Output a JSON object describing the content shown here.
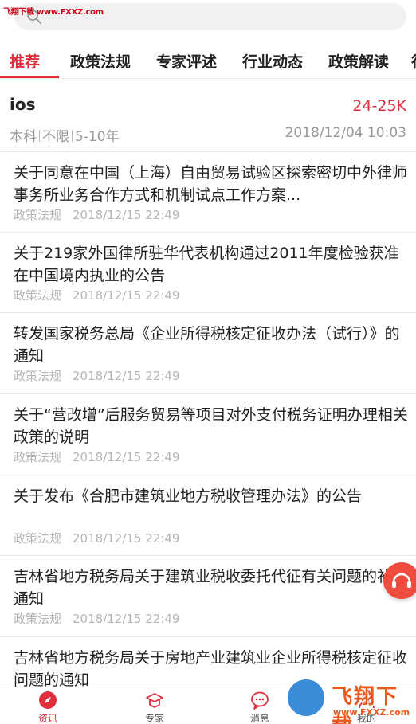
{
  "watermark_top": "飞翔下载 www.FXXZ.com",
  "search": {
    "placeholder": ""
  },
  "tabs": [
    {
      "label": "推荐",
      "active": true
    },
    {
      "label": "政策法规"
    },
    {
      "label": "专家评述"
    },
    {
      "label": "行业动态"
    },
    {
      "label": "政策解读"
    },
    {
      "label": "行"
    }
  ],
  "job": {
    "title": "ios",
    "salary": "24-25K",
    "education": "本科",
    "location": "不限",
    "experience": "5-10年",
    "time": "2018/12/04 10:03"
  },
  "articles": [
    {
      "title": "关于同意在中国（上海）自由贸易试验区探索密切中外律师事务所业务合作方式和机制试点工作方案...",
      "category": "政策法规",
      "date": "2018/12/15 22:49"
    },
    {
      "title": "关于219家外国律所驻华代表机构通过2011年度检验获准在中国境内执业的公告",
      "category": "政策法规",
      "date": "2018/12/15 22:49"
    },
    {
      "title": "转发国家税务总局《企业所得税核定征收办法（试行）》的通知",
      "category": "政策法规",
      "date": "2018/12/15 22:49"
    },
    {
      "title": "关于“营改增”后服务贸易等项目对外支付税务证明办理相关政策的说明",
      "category": "政策法规",
      "date": "2018/12/15 22:49"
    },
    {
      "title": "关于发布《合肥市建筑业地方税收管理办法》的公告",
      "category": "政策法规",
      "date": "2018/12/15 22:49"
    },
    {
      "title": "吉林省地方税务局关于建筑业税收委托代征有关问题的补充通知",
      "category": "政策法规",
      "date": "2018/12/15 22:49"
    },
    {
      "title": "吉林省地方税务局关于房地产业建筑业企业所得税核定征收问题的通知",
      "category": "",
      "date": ""
    }
  ],
  "bottom_nav": [
    {
      "label": "资讯",
      "icon": "compass-icon",
      "active": true
    },
    {
      "label": "专家",
      "icon": "graduation-cap-icon"
    },
    {
      "label": "消息",
      "icon": "chat-bubble-icon"
    },
    {
      "label": "我的",
      "icon": "user-icon"
    }
  ],
  "watermark_bottom": {
    "text": "飞翔下载",
    "url": "www.FXXZ.com"
  },
  "colors": {
    "accent": "#e02e3a",
    "meta": "#b5b5b5",
    "divider": "#e6e6e6"
  }
}
